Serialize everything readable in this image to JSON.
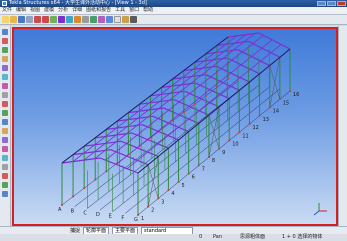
{
  "window": {
    "title": "Tekla Structures x64 - 大学生课外活动中心 - [View 1 - 3d]"
  },
  "menu": {
    "items": [
      "文件",
      "编辑",
      "视图",
      "建模",
      "分析",
      "详细",
      "图纸和报告",
      "工具",
      "窗口",
      "帮助"
    ]
  },
  "viewport": {
    "grid_labels": {
      "letters": [
        "A",
        "B",
        "C",
        "D",
        "E",
        "F",
        "G"
      ],
      "numbers": [
        "1",
        "2",
        "3",
        "4",
        "5",
        "6",
        "7",
        "8",
        "9",
        "10",
        "11",
        "12",
        "13",
        "14",
        "15",
        "16"
      ]
    }
  },
  "statusbar": {
    "snap_label": "捕捉",
    "plane_select": "轮廓平面",
    "work_select": "主要平面",
    "standard_field": "standard"
  },
  "infobar": {
    "col0": "0",
    "col1": "Pan",
    "col2": "思源粗体面",
    "col3": "1 + 0 选择的物体"
  },
  "colors": {
    "viewport_top": "#3f7ad8",
    "viewport_bottom": "#c9dbf3",
    "active_border": "#d32020",
    "steel_beam": "#7b2fd3",
    "column": "#2e8b3d",
    "column_base": "#d23a3a"
  }
}
